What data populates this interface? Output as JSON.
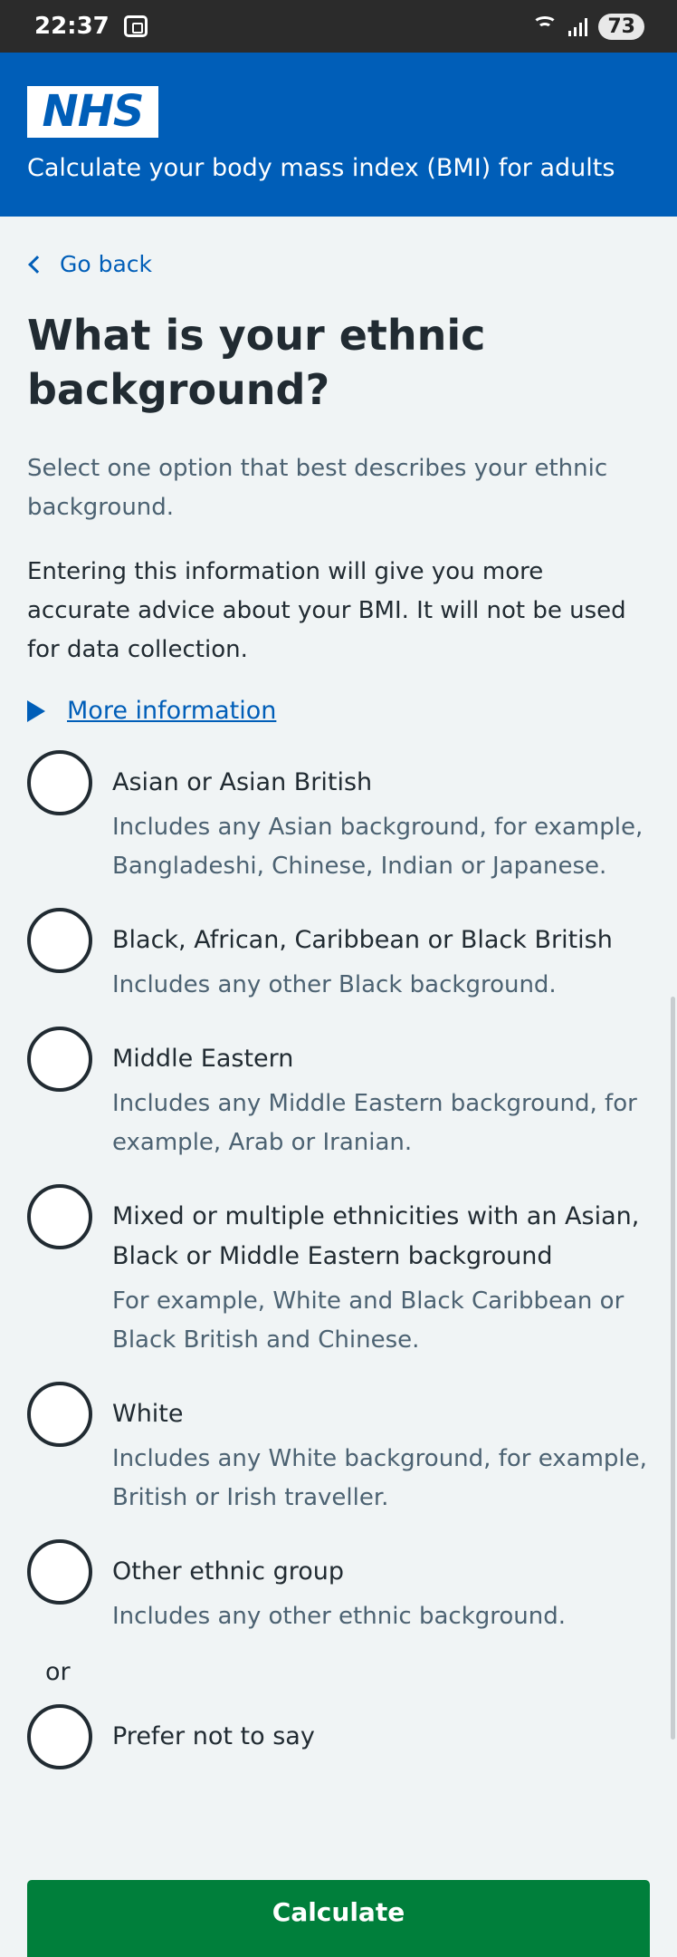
{
  "status_bar": {
    "time": "22:37",
    "battery": "73"
  },
  "header": {
    "logo": "NHS",
    "service_name": "Calculate your body mass index (BMI) for adults"
  },
  "back_link": "Go back",
  "page_title": "What is your ethnic background?",
  "hint": "Select one option that best describes your ethnic background.",
  "body_text": "Entering this information will give you more accurate advice about your BMI. It will not be used for data collection.",
  "details_summary": "More information",
  "options": [
    {
      "label": "Asian or Asian British",
      "hint": "Includes any Asian background, for example, Bangladeshi, Chinese, Indian or Japanese."
    },
    {
      "label": "Black, African, Caribbean or Black British",
      "hint": "Includes any other Black background."
    },
    {
      "label": "Middle Eastern",
      "hint": "Includes any Middle Eastern background, for example, Arab or Iranian."
    },
    {
      "label": "Mixed or multiple ethnicities with an Asian, Black or Middle Eastern background",
      "hint": "For example, White and Black Caribbean or Black British and Chinese."
    },
    {
      "label": "White",
      "hint": "Includes any White background, for example, British or Irish traveller."
    },
    {
      "label": "Other ethnic group",
      "hint": "Includes any other ethnic background."
    }
  ],
  "or_text": "or",
  "prefer_not": {
    "label": "Prefer not to say"
  },
  "calculate_label": "Calculate",
  "colors": {
    "header": "#005eb8",
    "link": "#005eb8",
    "button": "#007f3b",
    "background": "#f0f4f5"
  }
}
